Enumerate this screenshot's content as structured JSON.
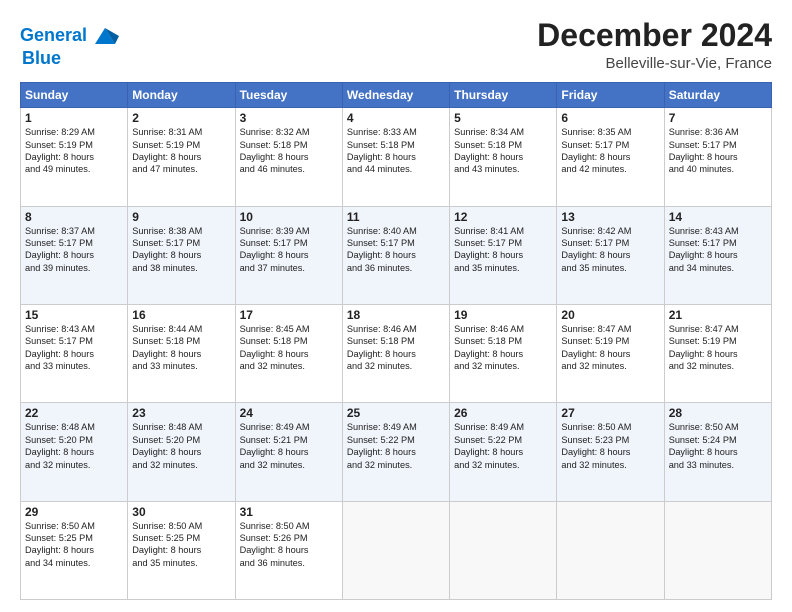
{
  "header": {
    "logo_line1": "General",
    "logo_line2": "Blue",
    "title": "December 2024",
    "subtitle": "Belleville-sur-Vie, France"
  },
  "days_of_week": [
    "Sunday",
    "Monday",
    "Tuesday",
    "Wednesday",
    "Thursday",
    "Friday",
    "Saturday"
  ],
  "weeks": [
    [
      {
        "day": "1",
        "lines": [
          "Sunrise: 8:29 AM",
          "Sunset: 5:19 PM",
          "Daylight: 8 hours",
          "and 49 minutes."
        ]
      },
      {
        "day": "2",
        "lines": [
          "Sunrise: 8:31 AM",
          "Sunset: 5:19 PM",
          "Daylight: 8 hours",
          "and 47 minutes."
        ]
      },
      {
        "day": "3",
        "lines": [
          "Sunrise: 8:32 AM",
          "Sunset: 5:18 PM",
          "Daylight: 8 hours",
          "and 46 minutes."
        ]
      },
      {
        "day": "4",
        "lines": [
          "Sunrise: 8:33 AM",
          "Sunset: 5:18 PM",
          "Daylight: 8 hours",
          "and 44 minutes."
        ]
      },
      {
        "day": "5",
        "lines": [
          "Sunrise: 8:34 AM",
          "Sunset: 5:18 PM",
          "Daylight: 8 hours",
          "and 43 minutes."
        ]
      },
      {
        "day": "6",
        "lines": [
          "Sunrise: 8:35 AM",
          "Sunset: 5:17 PM",
          "Daylight: 8 hours",
          "and 42 minutes."
        ]
      },
      {
        "day": "7",
        "lines": [
          "Sunrise: 8:36 AM",
          "Sunset: 5:17 PM",
          "Daylight: 8 hours",
          "and 40 minutes."
        ]
      }
    ],
    [
      {
        "day": "8",
        "lines": [
          "Sunrise: 8:37 AM",
          "Sunset: 5:17 PM",
          "Daylight: 8 hours",
          "and 39 minutes."
        ]
      },
      {
        "day": "9",
        "lines": [
          "Sunrise: 8:38 AM",
          "Sunset: 5:17 PM",
          "Daylight: 8 hours",
          "and 38 minutes."
        ]
      },
      {
        "day": "10",
        "lines": [
          "Sunrise: 8:39 AM",
          "Sunset: 5:17 PM",
          "Daylight: 8 hours",
          "and 37 minutes."
        ]
      },
      {
        "day": "11",
        "lines": [
          "Sunrise: 8:40 AM",
          "Sunset: 5:17 PM",
          "Daylight: 8 hours",
          "and 36 minutes."
        ]
      },
      {
        "day": "12",
        "lines": [
          "Sunrise: 8:41 AM",
          "Sunset: 5:17 PM",
          "Daylight: 8 hours",
          "and 35 minutes."
        ]
      },
      {
        "day": "13",
        "lines": [
          "Sunrise: 8:42 AM",
          "Sunset: 5:17 PM",
          "Daylight: 8 hours",
          "and 35 minutes."
        ]
      },
      {
        "day": "14",
        "lines": [
          "Sunrise: 8:43 AM",
          "Sunset: 5:17 PM",
          "Daylight: 8 hours",
          "and 34 minutes."
        ]
      }
    ],
    [
      {
        "day": "15",
        "lines": [
          "Sunrise: 8:43 AM",
          "Sunset: 5:17 PM",
          "Daylight: 8 hours",
          "and 33 minutes."
        ]
      },
      {
        "day": "16",
        "lines": [
          "Sunrise: 8:44 AM",
          "Sunset: 5:18 PM",
          "Daylight: 8 hours",
          "and 33 minutes."
        ]
      },
      {
        "day": "17",
        "lines": [
          "Sunrise: 8:45 AM",
          "Sunset: 5:18 PM",
          "Daylight: 8 hours",
          "and 32 minutes."
        ]
      },
      {
        "day": "18",
        "lines": [
          "Sunrise: 8:46 AM",
          "Sunset: 5:18 PM",
          "Daylight: 8 hours",
          "and 32 minutes."
        ]
      },
      {
        "day": "19",
        "lines": [
          "Sunrise: 8:46 AM",
          "Sunset: 5:18 PM",
          "Daylight: 8 hours",
          "and 32 minutes."
        ]
      },
      {
        "day": "20",
        "lines": [
          "Sunrise: 8:47 AM",
          "Sunset: 5:19 PM",
          "Daylight: 8 hours",
          "and 32 minutes."
        ]
      },
      {
        "day": "21",
        "lines": [
          "Sunrise: 8:47 AM",
          "Sunset: 5:19 PM",
          "Daylight: 8 hours",
          "and 32 minutes."
        ]
      }
    ],
    [
      {
        "day": "22",
        "lines": [
          "Sunrise: 8:48 AM",
          "Sunset: 5:20 PM",
          "Daylight: 8 hours",
          "and 32 minutes."
        ]
      },
      {
        "day": "23",
        "lines": [
          "Sunrise: 8:48 AM",
          "Sunset: 5:20 PM",
          "Daylight: 8 hours",
          "and 32 minutes."
        ]
      },
      {
        "day": "24",
        "lines": [
          "Sunrise: 8:49 AM",
          "Sunset: 5:21 PM",
          "Daylight: 8 hours",
          "and 32 minutes."
        ]
      },
      {
        "day": "25",
        "lines": [
          "Sunrise: 8:49 AM",
          "Sunset: 5:22 PM",
          "Daylight: 8 hours",
          "and 32 minutes."
        ]
      },
      {
        "day": "26",
        "lines": [
          "Sunrise: 8:49 AM",
          "Sunset: 5:22 PM",
          "Daylight: 8 hours",
          "and 32 minutes."
        ]
      },
      {
        "day": "27",
        "lines": [
          "Sunrise: 8:50 AM",
          "Sunset: 5:23 PM",
          "Daylight: 8 hours",
          "and 32 minutes."
        ]
      },
      {
        "day": "28",
        "lines": [
          "Sunrise: 8:50 AM",
          "Sunset: 5:24 PM",
          "Daylight: 8 hours",
          "and 33 minutes."
        ]
      }
    ],
    [
      {
        "day": "29",
        "lines": [
          "Sunrise: 8:50 AM",
          "Sunset: 5:25 PM",
          "Daylight: 8 hours",
          "and 34 minutes."
        ]
      },
      {
        "day": "30",
        "lines": [
          "Sunrise: 8:50 AM",
          "Sunset: 5:25 PM",
          "Daylight: 8 hours",
          "and 35 minutes."
        ]
      },
      {
        "day": "31",
        "lines": [
          "Sunrise: 8:50 AM",
          "Sunset: 5:26 PM",
          "Daylight: 8 hours",
          "and 36 minutes."
        ]
      },
      null,
      null,
      null,
      null
    ]
  ]
}
